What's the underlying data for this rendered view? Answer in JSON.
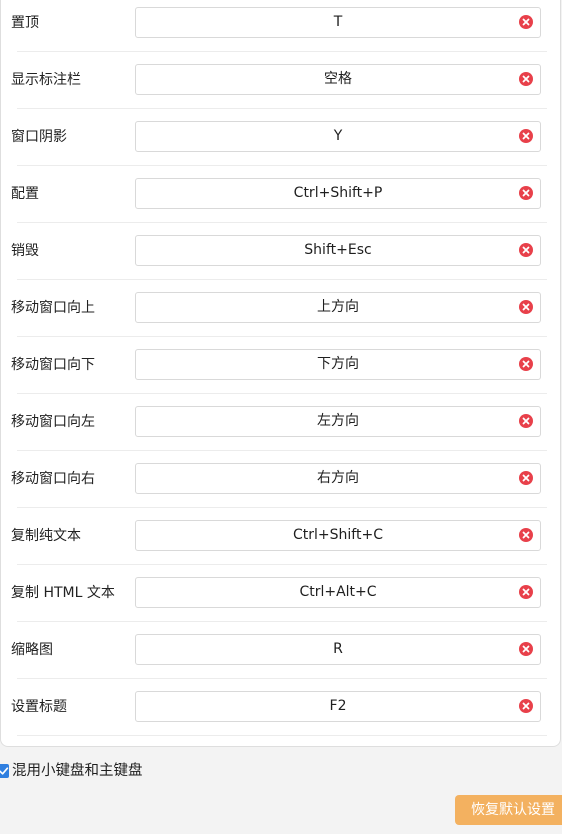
{
  "colors": {
    "clear_icon": "#e8404a",
    "checkbox": "#2f7fe0",
    "reset_button_bg": "#f3b160",
    "panel_bg": "#ffffff",
    "page_bg": "#f3f3f3"
  },
  "shortcuts": [
    {
      "label": "置顶",
      "value": "T",
      "clear_icon": "clear-icon"
    },
    {
      "label": "显示标注栏",
      "value": "空格",
      "clear_icon": "clear-icon"
    },
    {
      "label": "窗口阴影",
      "value": "Y",
      "clear_icon": "clear-icon"
    },
    {
      "label": "配置",
      "value": "Ctrl+Shift+P",
      "clear_icon": "clear-icon"
    },
    {
      "label": "销毁",
      "value": "Shift+Esc",
      "clear_icon": "clear-icon"
    },
    {
      "label": "移动窗口向上",
      "value": "上方向",
      "clear_icon": "clear-icon"
    },
    {
      "label": "移动窗口向下",
      "value": "下方向",
      "clear_icon": "clear-icon"
    },
    {
      "label": "移动窗口向左",
      "value": "左方向",
      "clear_icon": "clear-icon"
    },
    {
      "label": "移动窗口向右",
      "value": "右方向",
      "clear_icon": "clear-icon"
    },
    {
      "label": "复制纯文本",
      "value": "Ctrl+Shift+C",
      "clear_icon": "clear-icon"
    },
    {
      "label": "复制 HTML 文本",
      "value": "Ctrl+Alt+C",
      "clear_icon": "clear-icon"
    },
    {
      "label": "缩略图",
      "value": "R",
      "clear_icon": "clear-icon"
    },
    {
      "label": "设置标题",
      "value": "F2",
      "clear_icon": "clear-icon"
    }
  ],
  "options": {
    "mix_keypad_label": "混用小键盘和主键盘",
    "mix_keypad_checked": true
  },
  "footer": {
    "reset_label": "恢复默认设置"
  }
}
